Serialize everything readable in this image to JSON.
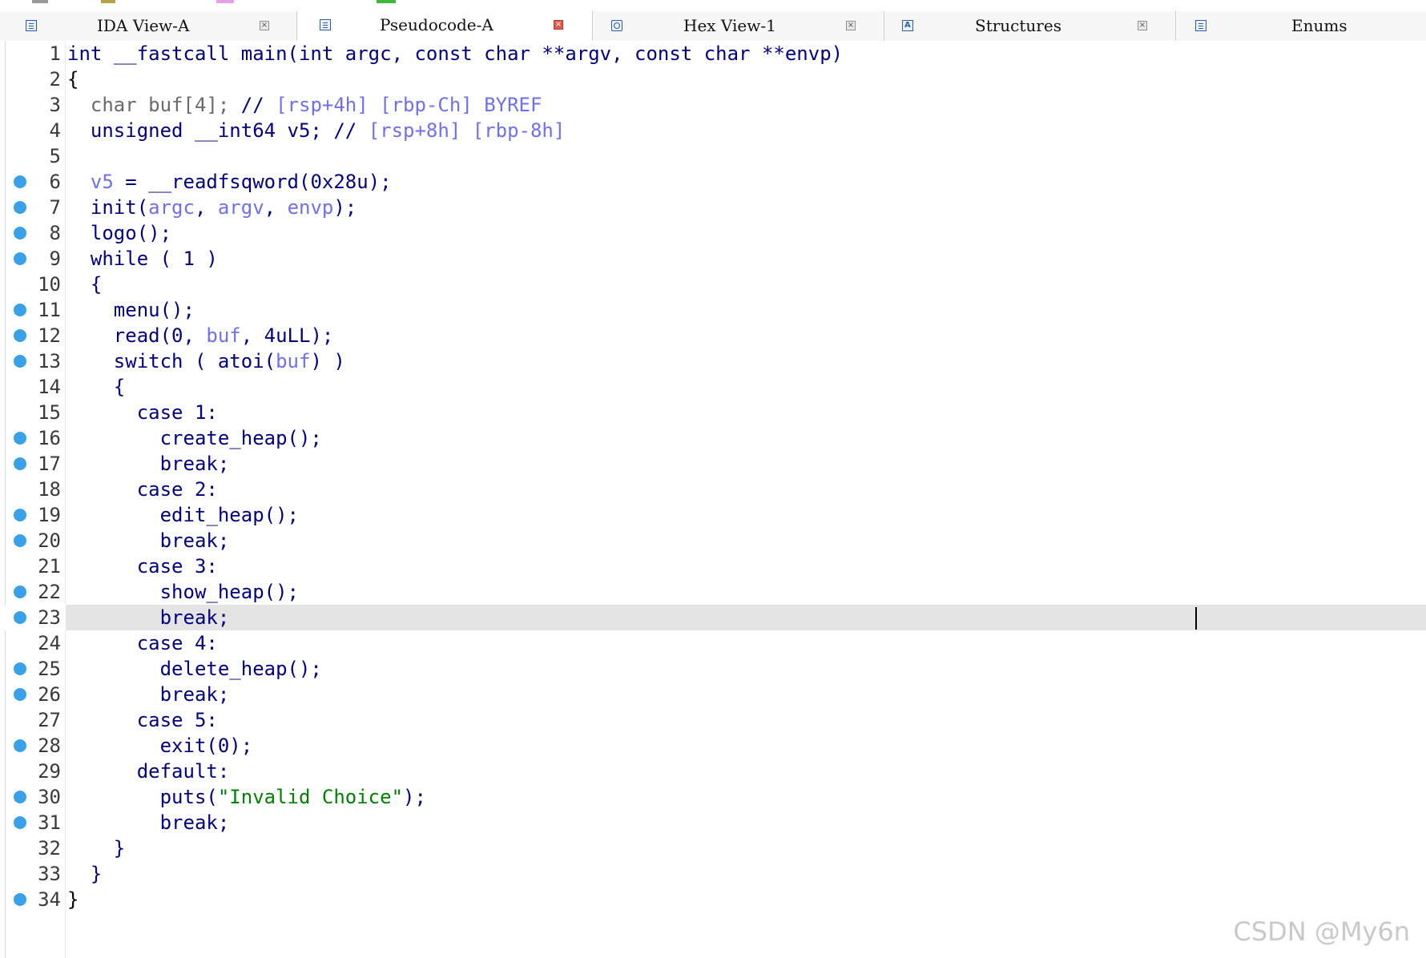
{
  "colors": {
    "keyword_navy": "#000080",
    "variable_lilac": "#6f6ff0",
    "comment_grey": "#6a6a6a",
    "string_green": "#008000",
    "breakpoint_blue": "#3aa0e8",
    "highlight_line": "#e4e4e4",
    "active_tab_close": "#e2574c"
  },
  "tabs": [
    {
      "label": "IDA View-A",
      "icon": "disassembly-icon",
      "active": false
    },
    {
      "label": "Pseudocode-A",
      "icon": "pseudocode-icon",
      "active": true
    },
    {
      "label": "Hex View-1",
      "icon": "hex-view-icon",
      "active": false
    },
    {
      "label": "Structures",
      "icon": "structures-icon",
      "active": false
    },
    {
      "label": "Enums",
      "icon": "enums-icon",
      "active": false
    }
  ],
  "close_glyph": "×",
  "code_lines": [
    {
      "n": "1",
      "dot": false,
      "tokens": [
        {
          "t": "int __fastcall main(int argc, const char **argv, const char **envp)",
          "c": ""
        }
      ]
    },
    {
      "n": "2",
      "dot": false,
      "tokens": [
        {
          "t": "{",
          "c": "k"
        }
      ]
    },
    {
      "n": "3",
      "dot": false,
      "tokens": [
        {
          "t": "  char buf[4]; ",
          "c": "g"
        },
        {
          "t": "// ",
          "c": ""
        },
        {
          "t": "[rsp+4h] [rbp-Ch] BYREF",
          "c": "v"
        }
      ]
    },
    {
      "n": "4",
      "dot": false,
      "tokens": [
        {
          "t": "  unsigned __int64 v5; // ",
          "c": ""
        },
        {
          "t": "[rsp+8h] [rbp-8h]",
          "c": "v"
        }
      ]
    },
    {
      "n": "5",
      "dot": false,
      "tokens": []
    },
    {
      "n": "6",
      "dot": true,
      "tokens": [
        {
          "t": "  ",
          "c": ""
        },
        {
          "t": "v5",
          "c": "v"
        },
        {
          "t": " = __readfsqword(0x28u);",
          "c": ""
        }
      ]
    },
    {
      "n": "7",
      "dot": true,
      "tokens": [
        {
          "t": "  init(",
          "c": ""
        },
        {
          "t": "argc",
          "c": "v"
        },
        {
          "t": ", ",
          "c": ""
        },
        {
          "t": "argv",
          "c": "v"
        },
        {
          "t": ", ",
          "c": ""
        },
        {
          "t": "envp",
          "c": "v"
        },
        {
          "t": ");",
          "c": ""
        }
      ]
    },
    {
      "n": "8",
      "dot": true,
      "tokens": [
        {
          "t": "  logo();",
          "c": ""
        }
      ]
    },
    {
      "n": "9",
      "dot": true,
      "tokens": [
        {
          "t": "  while ( 1 )",
          "c": ""
        }
      ]
    },
    {
      "n": "10",
      "dot": false,
      "tokens": [
        {
          "t": "  {",
          "c": ""
        }
      ]
    },
    {
      "n": "11",
      "dot": true,
      "tokens": [
        {
          "t": "    menu();",
          "c": ""
        }
      ]
    },
    {
      "n": "12",
      "dot": true,
      "tokens": [
        {
          "t": "    read(0, ",
          "c": ""
        },
        {
          "t": "buf",
          "c": "v"
        },
        {
          "t": ", 4uLL);",
          "c": ""
        }
      ]
    },
    {
      "n": "13",
      "dot": true,
      "tokens": [
        {
          "t": "    switch ( atoi(",
          "c": ""
        },
        {
          "t": "buf",
          "c": "v"
        },
        {
          "t": ") )",
          "c": ""
        }
      ]
    },
    {
      "n": "14",
      "dot": false,
      "tokens": [
        {
          "t": "    {",
          "c": ""
        }
      ]
    },
    {
      "n": "15",
      "dot": false,
      "tokens": [
        {
          "t": "      case 1:",
          "c": ""
        }
      ]
    },
    {
      "n": "16",
      "dot": true,
      "tokens": [
        {
          "t": "        create_heap();",
          "c": ""
        }
      ]
    },
    {
      "n": "17",
      "dot": true,
      "tokens": [
        {
          "t": "        break;",
          "c": ""
        }
      ]
    },
    {
      "n": "18",
      "dot": false,
      "tokens": [
        {
          "t": "      case 2:",
          "c": ""
        }
      ]
    },
    {
      "n": "19",
      "dot": true,
      "tokens": [
        {
          "t": "        edit_heap();",
          "c": ""
        }
      ]
    },
    {
      "n": "20",
      "dot": true,
      "tokens": [
        {
          "t": "        break;",
          "c": ""
        }
      ]
    },
    {
      "n": "21",
      "dot": false,
      "tokens": [
        {
          "t": "      case 3:",
          "c": ""
        }
      ]
    },
    {
      "n": "22",
      "dot": true,
      "tokens": [
        {
          "t": "        show_heap();",
          "c": ""
        }
      ]
    },
    {
      "n": "23",
      "dot": true,
      "highlight": true,
      "tokens": [
        {
          "t": "        break;",
          "c": ""
        }
      ]
    },
    {
      "n": "24",
      "dot": false,
      "tokens": [
        {
          "t": "      case 4:",
          "c": ""
        }
      ]
    },
    {
      "n": "25",
      "dot": true,
      "tokens": [
        {
          "t": "        delete_heap();",
          "c": ""
        }
      ]
    },
    {
      "n": "26",
      "dot": true,
      "tokens": [
        {
          "t": "        break;",
          "c": ""
        }
      ]
    },
    {
      "n": "27",
      "dot": false,
      "tokens": [
        {
          "t": "      case 5:",
          "c": ""
        }
      ]
    },
    {
      "n": "28",
      "dot": true,
      "tokens": [
        {
          "t": "        exit(0);",
          "c": ""
        }
      ]
    },
    {
      "n": "29",
      "dot": false,
      "tokens": [
        {
          "t": "      default:",
          "c": ""
        }
      ]
    },
    {
      "n": "30",
      "dot": true,
      "tokens": [
        {
          "t": "        puts(",
          "c": ""
        },
        {
          "t": "\"Invalid Choice\"",
          "c": "s"
        },
        {
          "t": ");",
          "c": ""
        }
      ]
    },
    {
      "n": "31",
      "dot": true,
      "tokens": [
        {
          "t": "        break;",
          "c": ""
        }
      ]
    },
    {
      "n": "32",
      "dot": false,
      "tokens": [
        {
          "t": "    }",
          "c": ""
        }
      ]
    },
    {
      "n": "33",
      "dot": false,
      "tokens": [
        {
          "t": "  }",
          "c": ""
        }
      ]
    },
    {
      "n": "34",
      "dot": true,
      "tokens": [
        {
          "t": "}",
          "c": "k"
        }
      ]
    }
  ],
  "watermark": "CSDN @My6n"
}
